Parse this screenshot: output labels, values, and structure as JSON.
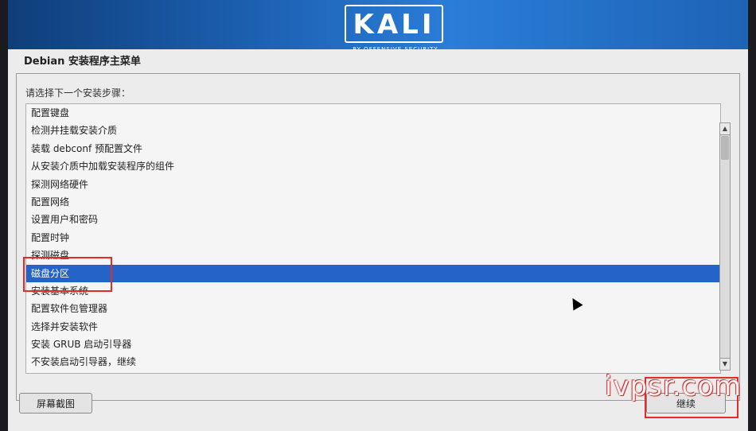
{
  "logo": {
    "text": "KALI",
    "subtitle": "BY OFFENSIVE SECURITY"
  },
  "window": {
    "title": "Debian 安装程序主菜单"
  },
  "prompt": "请选择下一个安装步骤：",
  "menu_items": [
    "配置键盘",
    "检测并挂载安装介质",
    "装载 debconf 预配置文件",
    "从安装介质中加载安装程序的组件",
    "探测网络硬件",
    "配置网络",
    "设置用户和密码",
    "配置时钟",
    "探测磁盘",
    "磁盘分区",
    "安装基本系统",
    "配置软件包管理器",
    "选择并安装软件",
    "安装 GRUB 启动引导器",
    "不安装启动引导器，继续"
  ],
  "selected_index": 9,
  "buttons": {
    "screenshot": "屏幕截图",
    "continue": "继续"
  },
  "watermark": "ivpsr.com",
  "colors": {
    "header": "#1d62b4",
    "selection": "#2563c9",
    "highlight_box": "#e52a2a"
  },
  "icons": {
    "scroll_up": "chevron-up-icon",
    "scroll_down": "chevron-down-icon",
    "cursor": "mouse-pointer-icon"
  }
}
